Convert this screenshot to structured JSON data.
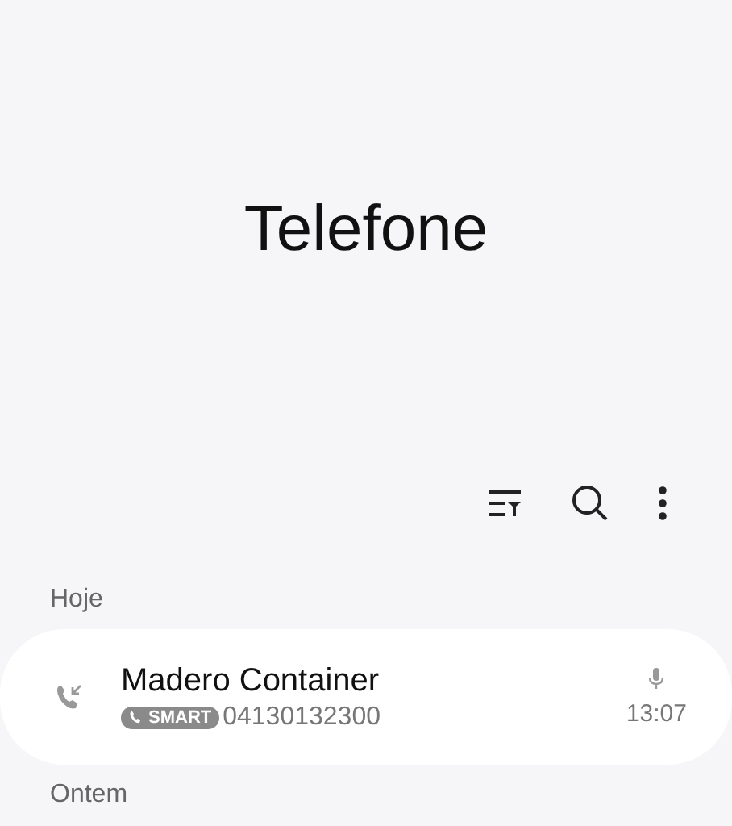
{
  "app_title": "Telefone",
  "sections": [
    {
      "label": "Hoje",
      "calls": [
        {
          "name": "Madero Container",
          "badge": "SMART",
          "number": "04130132300",
          "time": "13:07",
          "recorded": true
        }
      ]
    },
    {
      "label": "Ontem"
    }
  ]
}
